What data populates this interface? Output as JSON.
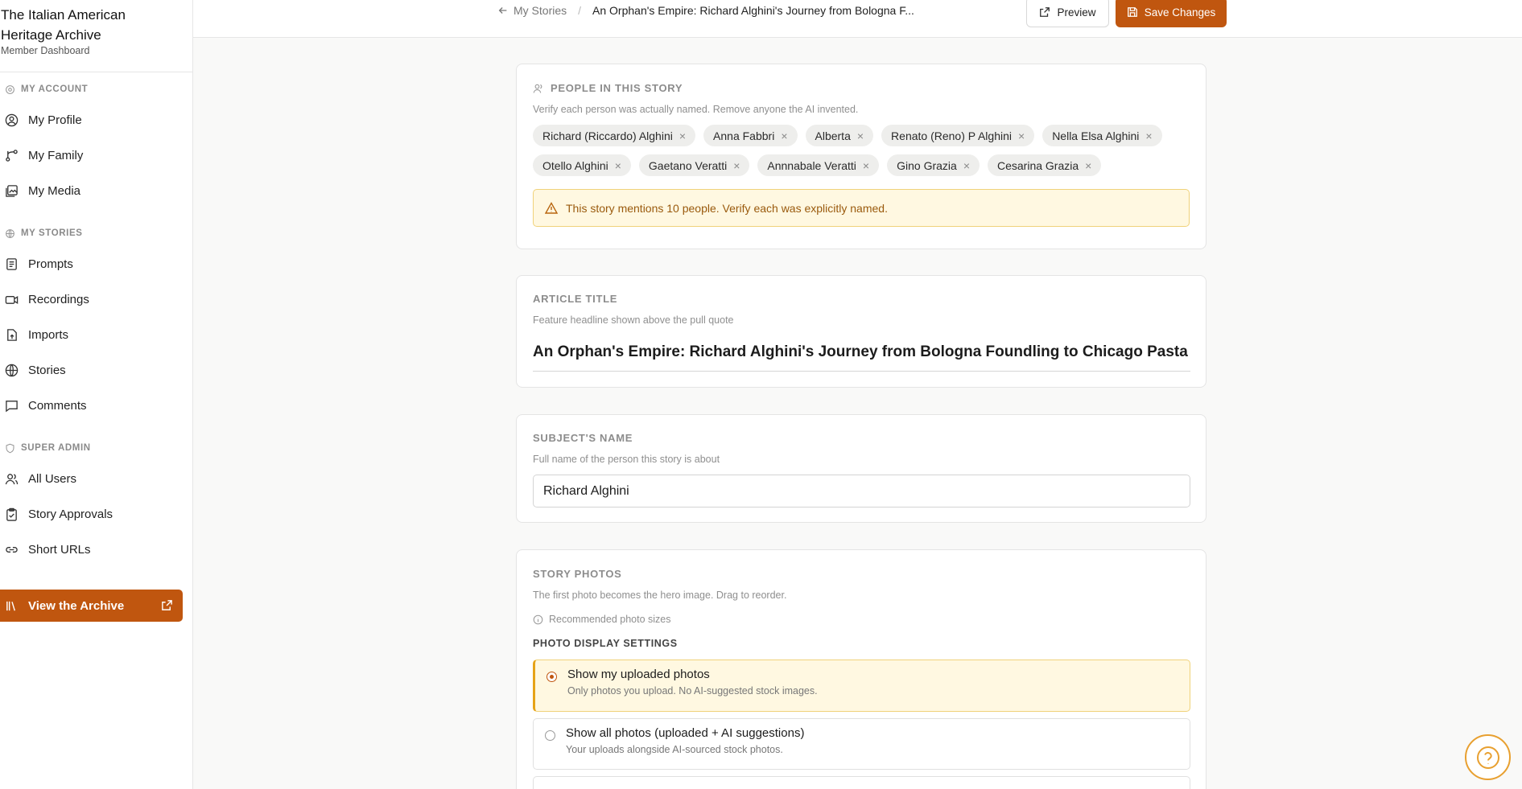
{
  "brand": {
    "title": "The Italian American Heritage Archive",
    "subtitle": "Member Dashboard"
  },
  "sidebar": {
    "sections": [
      {
        "label": "MY ACCOUNT",
        "items": [
          {
            "label": "My Profile"
          },
          {
            "label": "My Family"
          },
          {
            "label": "My Media"
          }
        ]
      },
      {
        "label": "MY STORIES",
        "items": [
          {
            "label": "Prompts"
          },
          {
            "label": "Recordings"
          },
          {
            "label": "Imports"
          },
          {
            "label": "Stories"
          },
          {
            "label": "Comments"
          }
        ]
      },
      {
        "label": "SUPER ADMIN",
        "items": [
          {
            "label": "All Users"
          },
          {
            "label": "Story Approvals"
          },
          {
            "label": "Short URLs"
          }
        ]
      }
    ],
    "archive_button": "View the Archive"
  },
  "topbar": {
    "breadcrumb_back": "My Stories",
    "breadcrumb_current": "An Orphan's Empire: Richard Alghini's Journey from Bologna F...",
    "preview_label": "Preview",
    "save_label": "Save Changes"
  },
  "people": {
    "label": "PEOPLE IN THIS STORY",
    "help": "Verify each person was actually named. Remove anyone the AI invented.",
    "chips": [
      "Richard (Riccardo) Alghini",
      "Anna Fabbri",
      "Alberta",
      "Renato (Reno) P Alghini",
      "Nella Elsa Alghini",
      "Otello Alghini",
      "Gaetano Veratti",
      "Annnabale Veratti",
      "Gino Grazia",
      "Cesarina Grazia"
    ],
    "remove_glyph": "×",
    "warning": "This story mentions 10 people. Verify each was explicitly named."
  },
  "article_title": {
    "label": "ARTICLE TITLE",
    "help": "Feature headline shown above the pull quote",
    "value": "An Orphan's Empire: Richard Alghini's Journey from Bologna Foundling to Chicago Pasta King"
  },
  "subject": {
    "label": "SUBJECT'S NAME",
    "help": "Full name of the person this story is about",
    "value": "Richard Alghini"
  },
  "photos": {
    "label": "STORY PHOTOS",
    "help": "The first photo becomes the hero image. Drag to reorder.",
    "recommended": "Recommended photo sizes",
    "display_label": "PHOTO DISPLAY SETTINGS",
    "options": [
      {
        "title": "Show my uploaded photos",
        "desc": "Only photos you upload. No AI-suggested stock images.",
        "selected": true
      },
      {
        "title": "Show all photos (uploaded + AI suggestions)",
        "desc": "Your uploads alongside AI-sourced stock photos.",
        "selected": false
      }
    ]
  },
  "colors": {
    "accent": "#c0560f",
    "warning_bg": "#fff8e1",
    "warning_border": "#f0d27a"
  }
}
